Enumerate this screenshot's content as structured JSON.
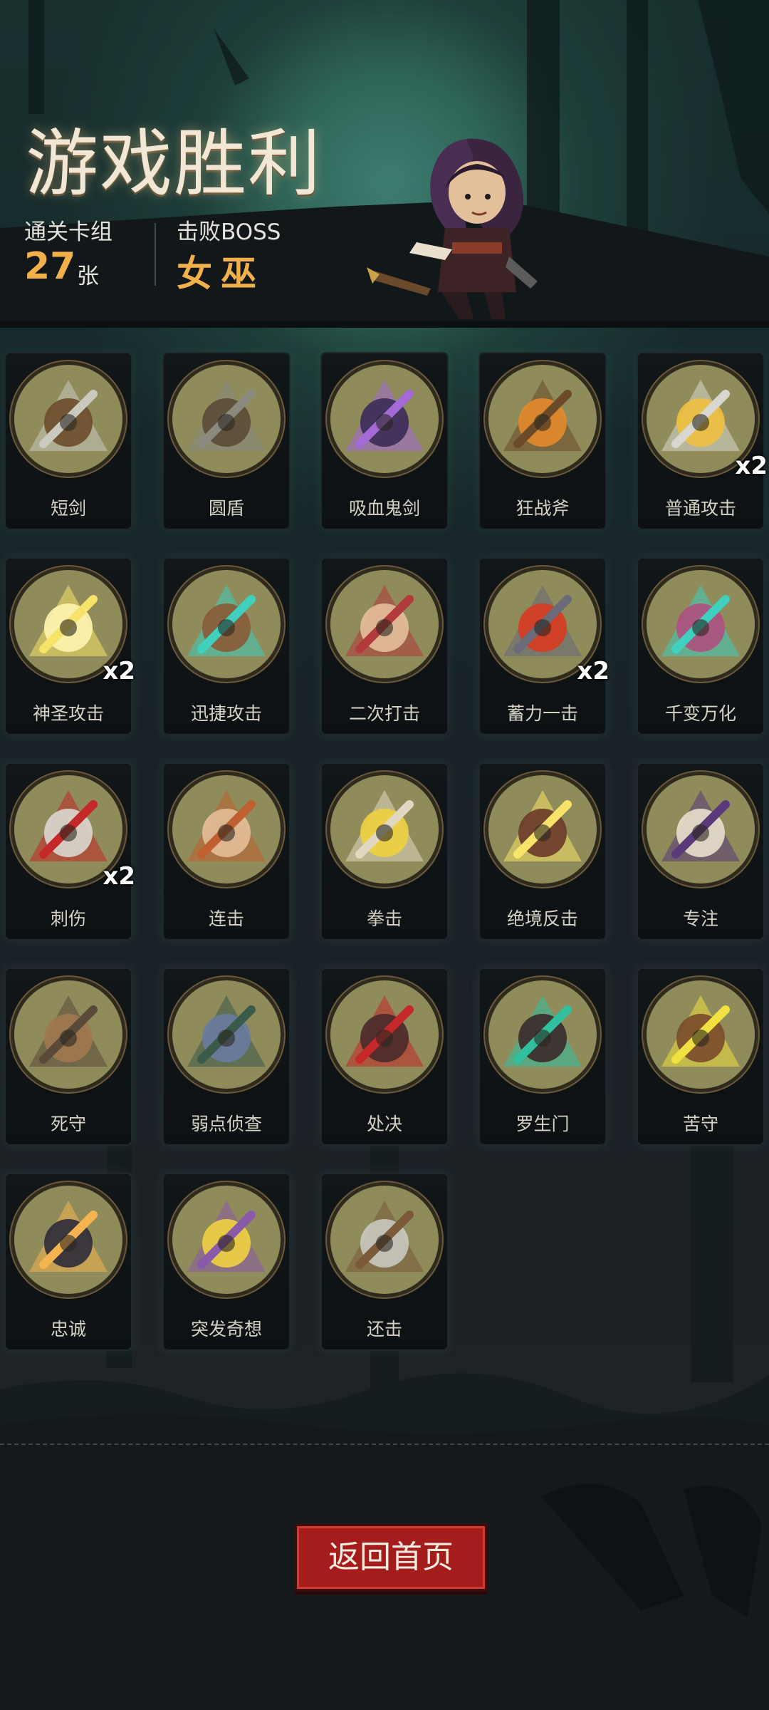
{
  "header": {
    "title": "游戏胜利",
    "deck_label": "通关卡组",
    "deck_count": "27",
    "deck_unit": "张",
    "boss_label": "击败BOSS",
    "boss_name": "女巫"
  },
  "cards": [
    {
      "name": "短剑",
      "badge": "",
      "icon": "dagger-icon"
    },
    {
      "name": "圆盾",
      "badge": "",
      "icon": "skull-shield-icon"
    },
    {
      "name": "吸血鬼剑",
      "badge": "",
      "icon": "vampire-sword-icon"
    },
    {
      "name": "狂战斧",
      "badge": "",
      "icon": "pumpkin-axe-icon"
    },
    {
      "name": "普通攻击",
      "badge": "x2",
      "icon": "sword-slash-icon"
    },
    {
      "name": "神圣攻击",
      "badge": "x2",
      "icon": "holy-light-icon"
    },
    {
      "name": "迅捷攻击",
      "badge": "",
      "icon": "swift-strike-icon"
    },
    {
      "name": "二次打击",
      "badge": "",
      "icon": "double-hit-icon"
    },
    {
      "name": "蓄力一击",
      "badge": "x2",
      "icon": "hammer-charge-icon"
    },
    {
      "name": "千变万化",
      "badge": "",
      "icon": "shapeshift-icon"
    },
    {
      "name": "刺伤",
      "badge": "x2",
      "icon": "stab-icon"
    },
    {
      "name": "连击",
      "badge": "",
      "icon": "archer-combo-icon"
    },
    {
      "name": "拳击",
      "badge": "",
      "icon": "skull-punch-icon"
    },
    {
      "name": "绝境反击",
      "badge": "",
      "icon": "desperate-counter-icon"
    },
    {
      "name": "专注",
      "badge": "",
      "icon": "focus-wizard-icon"
    },
    {
      "name": "死守",
      "badge": "",
      "icon": "last-stand-icon"
    },
    {
      "name": "弱点侦查",
      "badge": "",
      "icon": "wolf-weakness-icon"
    },
    {
      "name": "处决",
      "badge": "",
      "icon": "execution-icon"
    },
    {
      "name": "罗生门",
      "badge": "",
      "icon": "demon-gate-icon"
    },
    {
      "name": "苦守",
      "badge": "",
      "icon": "endurance-icon"
    },
    {
      "name": "忠诚",
      "badge": "",
      "icon": "cross-icon"
    },
    {
      "name": "突发奇想",
      "badge": "",
      "icon": "lightbulb-idea-icon"
    },
    {
      "name": "还击",
      "badge": "",
      "icon": "counter-attack-icon"
    }
  ],
  "footer": {
    "home_button": "返回首页"
  },
  "colors": {
    "accent": "#f2b04b",
    "button": "#a51c1c"
  }
}
